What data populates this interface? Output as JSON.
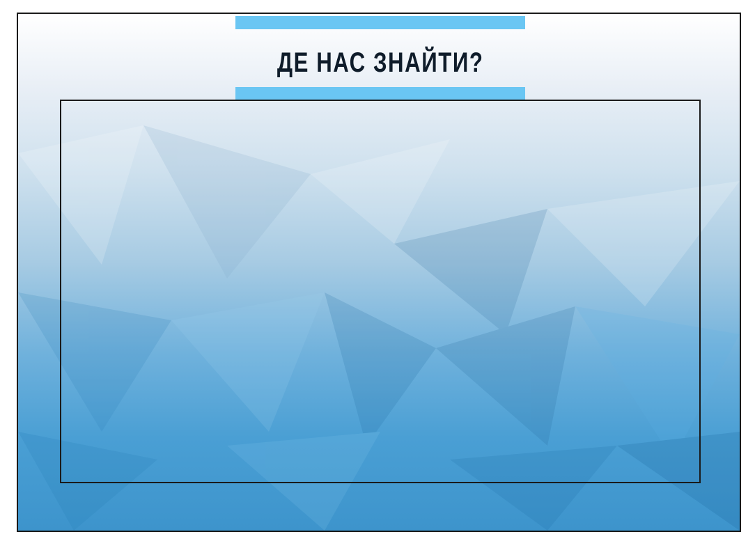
{
  "title": "ДЕ НАС ЗНАЙТИ?",
  "colors": {
    "accent_bar": "#6ac6f3",
    "title_text": "#0f1c2a",
    "frame_border": "#1a1a1a"
  }
}
